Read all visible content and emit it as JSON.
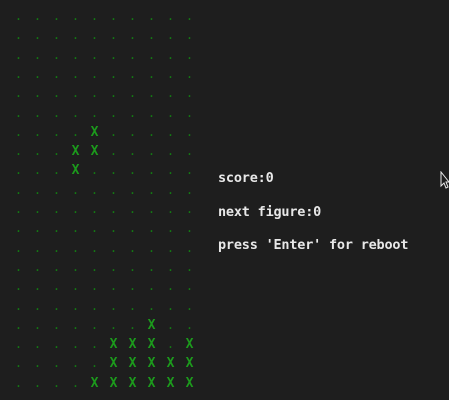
{
  "game": {
    "score_text": "score:0",
    "next_figure_text": "next figure:0",
    "reboot_text": "press 'Enter' for reboot",
    "empty_symbol": ".",
    "filled_symbol": "X",
    "colors": {
      "background": "#1e1e1e",
      "cell": "#1c9a1c",
      "text": "#e8e8e8"
    }
  },
  "board": {
    "columns": 10,
    "rows": 20,
    "grid": [
      "..........",
      "..........",
      "..........",
      "..........",
      "..........",
      "..........",
      "....X.....",
      "...XX.....",
      "...X......",
      "..........",
      "..........",
      "..........",
      "..........",
      "..........",
      "..........",
      "..........",
      ".......X..",
      ".....XXX.X",
      ".....XXXXX",
      "....XXXXXX"
    ]
  }
}
